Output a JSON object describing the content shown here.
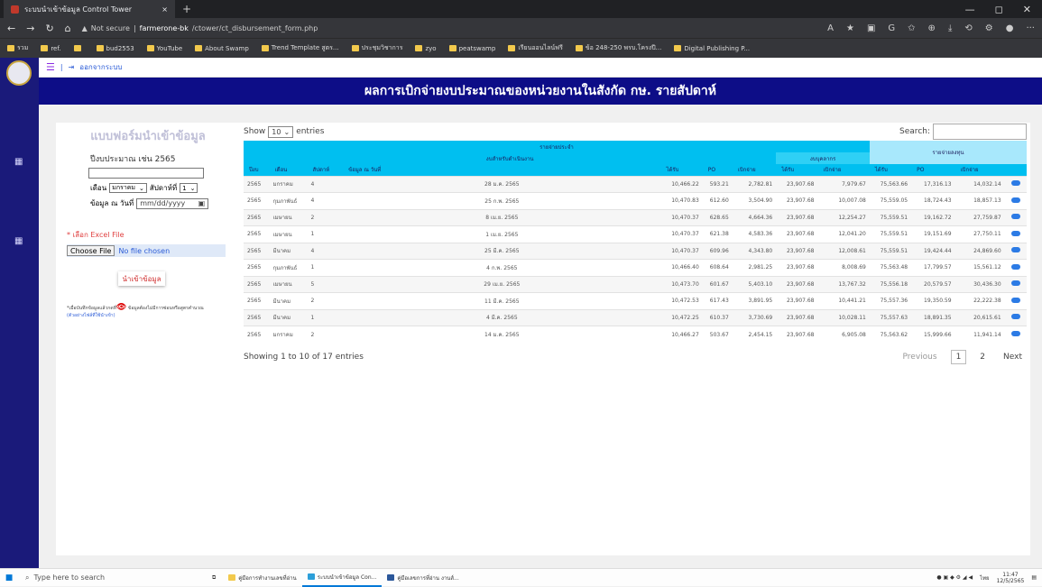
{
  "browser": {
    "tab_title": "ระบบนำเข้าข้อมูล Control Tower",
    "tab_close": "×",
    "new_tab": "+",
    "security": "Not secure",
    "url_host": "farmerone-bk",
    "url_path": "/ctower/ct_disbursement_form.php",
    "bookmarks": [
      "รวม",
      "ref.",
      "",
      "bud2553",
      "YouTube",
      "About Swamp",
      "Trend Template สูตร...",
      "ประชุมวิชาการ",
      "zyo",
      "peatswamp",
      "เรียนออนไลน์ฟรี",
      "ข้อ 248-250 พรบ.โครงปี...",
      "Digital Publishing P..."
    ]
  },
  "app": {
    "logout": "ออกจากระบบ",
    "header": "ผลการเบิกจ่ายงบประมาณของหน่วยงานในสังกัด กษ. รายสัปดาห์"
  },
  "form": {
    "title": "แบบฟอร์มนำเข้าข้อมูล",
    "year_label": "ปีงบประมาณ เช่น 2565",
    "year_value": "",
    "month_label": "เดือน",
    "month_value": "มกราคม",
    "week_label": "สัปดาห์ที่",
    "week_value": "1",
    "date_label": "ข้อมูล ณ วันที่",
    "date_placeholder": "mm/dd/yyyy",
    "excel_label": "* เลือก Excel File",
    "choose_file": "Choose File",
    "no_file": "No file chosen",
    "import_button": "นำเข้าข้อมูล",
    "note_prefix": "*เมื่อบันทึกข้อมูลแล้วกดที่",
    "note_icon": "👁",
    "note_suffix": " ข้อมูลต้องไม่มีการซ่อนหรือสูตรคำนวณ",
    "note_link": "(ตัวอย่างไฟล์ที่ใช้นำเข้า)"
  },
  "table": {
    "show": "Show",
    "length_value": "10",
    "entries": "entries",
    "search_label": "Search:",
    "group_regular": "รายจ่ายประจำ",
    "group_invest": "รายจ่ายลงทุน",
    "sub_operating": "งบสำหรับดำเนินงาน",
    "sub_personnel": "งบบุคลากร",
    "columns": [
      "ปีงบ",
      "เดือน",
      "สัปดาห์",
      "ข้อมูล ณ วันที่",
      "ได้รับ",
      "PO",
      "เบิกจ่าย",
      "ได้รับ",
      "เบิกจ่าย",
      "ได้รับ",
      "PO",
      "เบิกจ่าย",
      ""
    ],
    "rows": [
      [
        "2565",
        "มกราคม",
        "4",
        "28 ม.ค. 2565",
        "10,466.22",
        "593.21",
        "2,782.81",
        "23,907.68",
        "7,979.67",
        "75,563.66",
        "17,316.13",
        "14,032.14"
      ],
      [
        "2565",
        "กุมภาพันธ์",
        "4",
        "25 ก.พ. 2565",
        "10,470.83",
        "612.60",
        "3,504.90",
        "23,907.68",
        "10,007.08",
        "75,559.05",
        "18,724.43",
        "18,857.13"
      ],
      [
        "2565",
        "เมษายน",
        "2",
        "8 เม.ย. 2565",
        "10,470.37",
        "628.65",
        "4,664.36",
        "23,907.68",
        "12,254.27",
        "75,559.51",
        "19,162.72",
        "27,759.87"
      ],
      [
        "2565",
        "เมษายน",
        "1",
        "1 เม.ย. 2565",
        "10,470.37",
        "621.38",
        "4,583.36",
        "23,907.68",
        "12,041.20",
        "75,559.51",
        "19,151.69",
        "27,750.11"
      ],
      [
        "2565",
        "มีนาคม",
        "4",
        "25 มี.ค. 2565",
        "10,470.37",
        "609.96",
        "4,343.80",
        "23,907.68",
        "12,008.61",
        "75,559.51",
        "19,424.44",
        "24,869.60"
      ],
      [
        "2565",
        "กุมภาพันธ์",
        "1",
        "4 ก.พ. 2565",
        "10,466.40",
        "608.64",
        "2,981.25",
        "23,907.68",
        "8,008.69",
        "75,563.48",
        "17,799.57",
        "15,561.12"
      ],
      [
        "2565",
        "เมษายน",
        "5",
        "29 เม.ย. 2565",
        "10,473.70",
        "601.67",
        "5,403.10",
        "23,907.68",
        "13,767.32",
        "75,556.18",
        "20,579.57",
        "30,436.30"
      ],
      [
        "2565",
        "มีนาคม",
        "2",
        "11 มี.ค. 2565",
        "10,472.53",
        "617.43",
        "3,891.95",
        "23,907.68",
        "10,441.21",
        "75,557.36",
        "19,350.59",
        "22,222.38"
      ],
      [
        "2565",
        "มีนาคม",
        "1",
        "4 มี.ค. 2565",
        "10,472.25",
        "610.37",
        "3,730.69",
        "23,907.68",
        "10,028.11",
        "75,557.63",
        "18,891.35",
        "20,615.61"
      ],
      [
        "2565",
        "มกราคม",
        "2",
        "14 ม.ค. 2565",
        "10,466.27",
        "503.67",
        "2,454.15",
        "23,907.68",
        "6,905.08",
        "75,563.62",
        "15,999.66",
        "11,941.14"
      ]
    ],
    "info": "Showing 1 to 10 of 17 entries",
    "prev": "Previous",
    "page1": "1",
    "page2": "2",
    "next": "Next"
  },
  "taskbar": {
    "search": "Type here to search",
    "apps": [
      "คู่มือการทำงานเลขที่อ่าน",
      "ระบบนำเข้าข้อมูล Con...",
      "คู่มือเลขการที่อ่าน งานส์..."
    ],
    "lang": "ไทย",
    "time": "11:47",
    "date": "12/5/2565"
  }
}
